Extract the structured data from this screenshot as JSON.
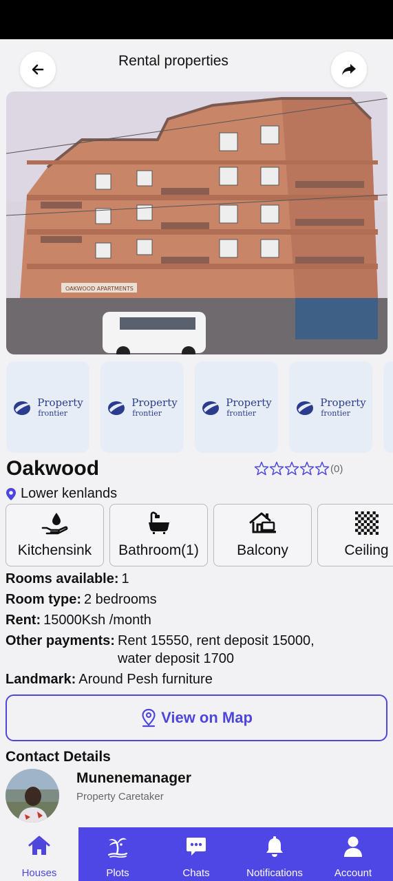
{
  "header": {
    "title": "Rental properties",
    "back_icon": "arrow-left-icon",
    "share_icon": "share-arrow-icon"
  },
  "gallery": {
    "main_image": "apartment-building-photo",
    "thumbnails": [
      {
        "brand_top": "Property",
        "brand_bottom": "frontier"
      },
      {
        "brand_top": "Property",
        "brand_bottom": "frontier"
      },
      {
        "brand_top": "Property",
        "brand_bottom": "frontier"
      },
      {
        "brand_top": "Property",
        "brand_bottom": "frontier"
      }
    ]
  },
  "property": {
    "name": "Oakwood",
    "rating_stars": 0,
    "rating_count": "(0)",
    "location": "Lower kenlands"
  },
  "amenities": [
    {
      "label": "Kitchensink",
      "icon": "kitchen-sink-icon"
    },
    {
      "label": "Bathroom(1)",
      "icon": "bathtub-icon"
    },
    {
      "label": "Balcony",
      "icon": "house-laptop-icon"
    },
    {
      "label": "Ceiling",
      "icon": "checkered-pattern-icon"
    }
  ],
  "details": {
    "rooms_available_label": "Rooms available:",
    "rooms_available": "1",
    "room_type_label": "Room type:",
    "room_type": "2 bedrooms",
    "rent_label": "Rent:",
    "rent": "15000Ksh /month",
    "other_payments_label": "Other payments:",
    "other_payments_line1": "Rent 15550, rent deposit 15000,",
    "other_payments_line2": "water deposit 1700",
    "landmark_label": "Landmark:",
    "landmark": "Around Pesh furniture"
  },
  "map_button": {
    "label": "View on Map",
    "icon": "map-pin-icon"
  },
  "contact": {
    "title": "Contact Details",
    "name": "Munenemanager",
    "role": "Property Caretaker"
  },
  "nav": [
    {
      "label": "Houses",
      "icon": "house-icon",
      "active": true
    },
    {
      "label": "Plots",
      "icon": "island-palm-icon",
      "active": false
    },
    {
      "label": "Chats",
      "icon": "chat-bubble-icon",
      "active": false
    },
    {
      "label": "Notifications",
      "icon": "bell-icon",
      "active": false
    },
    {
      "label": "Account",
      "icon": "user-icon",
      "active": false
    }
  ],
  "colors": {
    "accent": "#4e46e5",
    "background": "#f2f2f4"
  }
}
